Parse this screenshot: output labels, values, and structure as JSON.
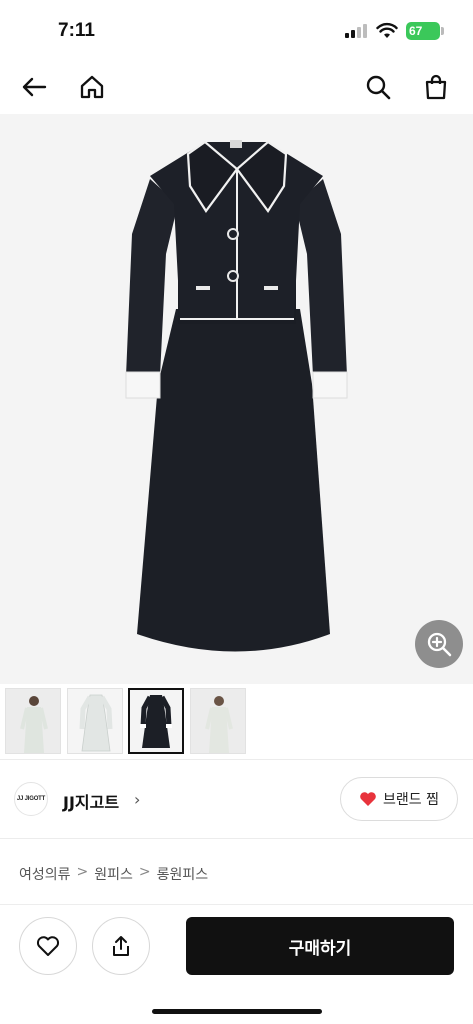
{
  "status_bar": {
    "time": "7:11",
    "battery": "67"
  },
  "nav": {
    "icons": [
      "back-arrow-icon",
      "home-icon",
      "search-icon",
      "shopping-bag-icon"
    ]
  },
  "product": {
    "zoom_icon": "zoom-in-icon",
    "thumbnail_count": 4,
    "selected_thumbnail": 3
  },
  "brand": {
    "logo_text": "JJ JIGOTT",
    "name": "JJ지고트",
    "arrow": "›",
    "fav_label": "브랜드 찜"
  },
  "breadcrumb": {
    "items": [
      "여성의류",
      "원피스",
      "롱원피스"
    ],
    "separator": ">"
  },
  "bottom_bar": {
    "buy_label": "구매하기"
  },
  "colors": {
    "accent": "#111111",
    "heart": "#e8333c",
    "battery": "#3bc85a"
  }
}
